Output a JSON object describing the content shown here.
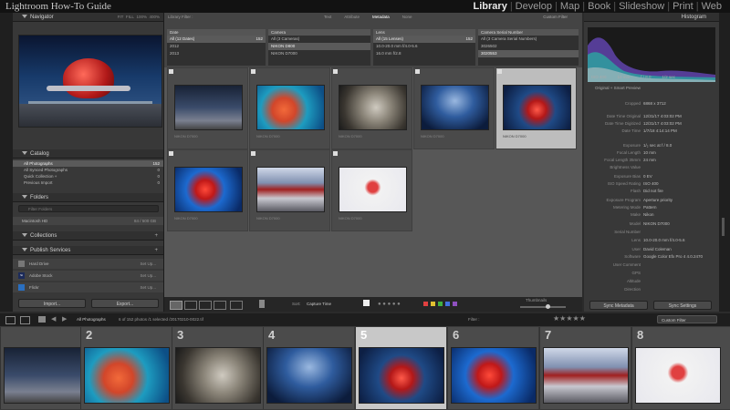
{
  "app": {
    "title": "Lightroom How-To Guide"
  },
  "modules": [
    {
      "label": "Library",
      "active": true
    },
    {
      "label": "Develop"
    },
    {
      "label": "Map"
    },
    {
      "label": "Book"
    },
    {
      "label": "Slideshow"
    },
    {
      "label": "Print"
    },
    {
      "label": "Web"
    }
  ],
  "left": {
    "navigator": {
      "title": "Navigator",
      "zoom": [
        "FIT",
        "FILL",
        "100%",
        "400%"
      ]
    },
    "catalog": {
      "title": "Catalog",
      "items": [
        {
          "label": "All Photographs",
          "count": "152"
        },
        {
          "label": "All Synced Photographs",
          "count": "0"
        },
        {
          "label": "Quick Collection +",
          "count": "0"
        },
        {
          "label": "Previous Import",
          "count": "0"
        }
      ]
    },
    "folders": {
      "title": "Folders",
      "search_placeholder": "Filter Folders",
      "volume": "Macintosh HD",
      "volume_size": "84 / 500 GB"
    },
    "collections": {
      "title": "Collections"
    },
    "publish": {
      "title": "Publish Services",
      "items": [
        {
          "label": "Hard Drive",
          "action": "Set Up..."
        },
        {
          "label": "Adobe Stock",
          "action": "Set Up..."
        },
        {
          "label": "Flickr",
          "action": "Set Up..."
        }
      ]
    },
    "import_label": "Import...",
    "export_label": "Export..."
  },
  "filterbar": {
    "title": "Library Filter :",
    "tabs": [
      "Text",
      "Attribute",
      "Metadata",
      "None"
    ],
    "preset": "Custom Filter",
    "columns": [
      {
        "header": "Date",
        "rows": [
          [
            "All (12 Dates)",
            "152"
          ],
          [
            "2012",
            ""
          ],
          [
            "2013",
            ""
          ]
        ]
      },
      {
        "header": "Camera",
        "rows": [
          [
            "All (3 Cameras)",
            ""
          ],
          [
            "NIKON D800",
            ""
          ],
          [
            "NIKON D7000",
            ""
          ]
        ]
      },
      {
        "header": "Lens",
        "rows": [
          [
            "All (15 Lenses)",
            "152"
          ],
          [
            "10.0-20.0 mm f/4.0-5.6",
            ""
          ],
          [
            "16.0 mm f/2.8",
            ""
          ]
        ]
      },
      {
        "header": "Camera Serial Number",
        "rows": [
          [
            "All (3 Camera Serial Numbers)",
            ""
          ],
          [
            "3026502",
            ""
          ],
          [
            "3020553",
            ""
          ]
        ]
      }
    ]
  },
  "grid": {
    "row1": [
      "NIKON D7000",
      "NIKON D7000",
      "NIKON D7000",
      "NIKON D7000",
      "NIKON D7000"
    ],
    "row2": [
      "NIKON D7000",
      "NIKON D7000",
      "NIKON D7000"
    ]
  },
  "toolbar": {
    "sort_label": "Sort:",
    "sort_value": "Capture Time",
    "thumbnails": "Thumbnails",
    "colors": [
      "#e04040",
      "#e0c030",
      "#40b040",
      "#4070e0",
      "#9050c0"
    ]
  },
  "right": {
    "histogram": {
      "title": "Histogram",
      "info": [
        "ISO 400",
        "10 mm",
        "f / 8.0",
        "1/2 sec"
      ]
    },
    "preview": "Original + Smart Preview",
    "metadata": [
      [
        "Cropped",
        "6868 x 3712"
      ],
      [
        "Date Time Original",
        "12/31/17 4:03:02 PM"
      ],
      [
        "Date Time Digitized",
        "12/31/17 4:03:02 PM"
      ],
      [
        "Date Time",
        "1/7/18 4:14:14 PM"
      ],
      [
        "Exposure",
        "1/₂ sec at f / 8.0"
      ],
      [
        "Focal Length",
        "10 mm"
      ],
      [
        "Focal Length 35mm",
        "24 mm"
      ],
      [
        "Brightness Value",
        ""
      ],
      [
        "Exposure Bias",
        "0 EV"
      ],
      [
        "ISO Speed Rating",
        "ISO 400"
      ],
      [
        "Flash",
        "Did not fire"
      ],
      [
        "Exposure Program",
        "Aperture priority"
      ],
      [
        "Metering Mode",
        "Pattern"
      ],
      [
        "Make",
        "Nikon"
      ],
      [
        "Model",
        "NIKON D7000"
      ],
      [
        "Serial Number",
        ""
      ],
      [
        "Lens",
        "10.0-20.0 mm f/4.0-5.6"
      ],
      [
        "User",
        "David Coleman"
      ],
      [
        "Software",
        "Google Color Efx Pro 4 4.0.2470"
      ],
      [
        "User Comment",
        ""
      ],
      [
        "GPS",
        ""
      ],
      [
        "Altitude",
        ""
      ],
      [
        "Direction",
        ""
      ]
    ],
    "sync_metadata": "Sync Metadata",
    "sync_settings": "Sync Settings"
  },
  "filmstrip": {
    "source": "All Photographs",
    "status": "6 of 152 photos /1 selected /20170210-0022.tif",
    "filter_label": "Filter :",
    "filter_value": "Custom Filter",
    "numbers": [
      "",
      "2",
      "3",
      "4",
      "5",
      "6",
      "7",
      "8"
    ]
  }
}
